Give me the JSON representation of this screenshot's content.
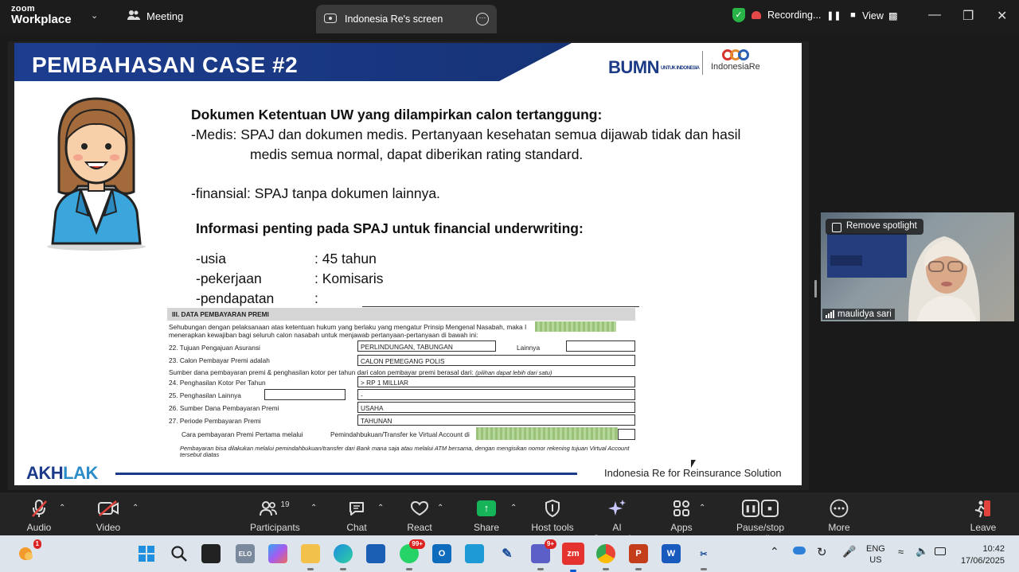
{
  "topbar": {
    "brand_line1": "zoom",
    "brand_line2": "Workplace",
    "meeting_tab": "Meeting",
    "screen_tab": "Indonesia Re's screen",
    "recording_label": "Recording...",
    "view_label": "View"
  },
  "slide": {
    "title": "PEMBAHASAN CASE #2",
    "logo_bumn": "BUMN",
    "logo_bumn_sub": "UNTUK INDONESIA",
    "logo_ire": "IndonesiaRe",
    "heading1": "Dokumen Ketentuan UW yang dilampirkan calon tertanggung:",
    "medis_line1": "-Medis: SPAJ dan dokumen medis. Pertanyaan kesehatan semua dijawab tidak dan hasil",
    "medis_line2": "medis semua normal, dapat diberikan rating standard.",
    "finansial_line": "-finansial: SPAJ tanpa dokumen lainnya.",
    "heading2": "Informasi penting pada SPAJ untuk financial underwriting:",
    "info": [
      {
        "label": "-usia",
        "value": ": 45 tahun"
      },
      {
        "label": "-pekerjaan",
        "value": ": Komisaris"
      },
      {
        "label": "-pendapatan",
        "value": ":"
      }
    ],
    "footer_left_a": "AKH",
    "footer_left_b": "LAK",
    "footer_right": "Indonesia Re for Reinsurance Solution"
  },
  "form": {
    "section_title": "III. DATA PEMBAYARAN PREMI",
    "intro_line1": "Sehubungan dengan pelaksanaan atas ketentuan hukum yang berlaku yang mengatur Prinsip Mengenal Nasabah, maka I",
    "intro_line2": "menerapkan  kewajiban bagi seluruh calon nasabah untuk  menjawab pertanyaan-pertanyaan di bawah ini:",
    "q22_label": "22.  Tujuan Pengajuan Asuransi",
    "q22_value": "PERLINDUNGAN, TABUNGAN",
    "q22_other": "Lainnya",
    "q23_label": "23.  Calon Pembayar Premi adalah",
    "q23_value": "CALON PEMEGANG POLIS",
    "source_line": "Sumber dana pembayaran premi & penghasilan kotor per tahun dari calon pembayar premi berasal dari:",
    "source_note": "(pilihan dapat lebih dari satu)",
    "q24_label": "24.  Penghasilan Kotor Per Tahun",
    "q24_value": "> RP 1 MILLIAR",
    "q25_label": "25.  Penghasilan Lainnya",
    "q25_value": "-",
    "q26_label": "26.  Sumber Dana Pembayaran Premi",
    "q26_value": "USAHA",
    "q27_label": "27.  Periode Pembayaran Premi",
    "q27_value": "TAHUNAN",
    "pay_label": "Cara pembayaran Premi Pertama melalui",
    "pay_value": "Pemindahbukuan/Transfer ke Virtual Account di",
    "note_line1": "Pembayaran bisa dilakukan melalui pemindahbukuan/transfer dari Bank mana saja atau melalui ATM bersama, dengan mengisikan nomor rekening tujuan Virtual Account",
    "note_line2": "tersebut diatas"
  },
  "video": {
    "spotlight_btn": "Remove spotlight",
    "participant_name": "maulidya sari"
  },
  "toolbar": {
    "audio": "Audio",
    "video": "Video",
    "participants": "Participants",
    "participants_count": "19",
    "chat": "Chat",
    "react": "React",
    "share": "Share",
    "host_tools": "Host tools",
    "ai_companion": "AI Companion",
    "apps": "Apps",
    "pause_stop": "Pause/stop recording",
    "more": "More",
    "leave": "Leave"
  },
  "taskbar": {
    "widget_badge": "1",
    "whatsapp_badge": "99+",
    "teams_badge": "9+",
    "lang1": "ENG",
    "lang2": "US",
    "time": "10:42",
    "date": "17/06/2025"
  },
  "colors": {
    "slide_header": "#1b3a8a",
    "share_green": "#17b359",
    "recording_red": "#e54848"
  }
}
